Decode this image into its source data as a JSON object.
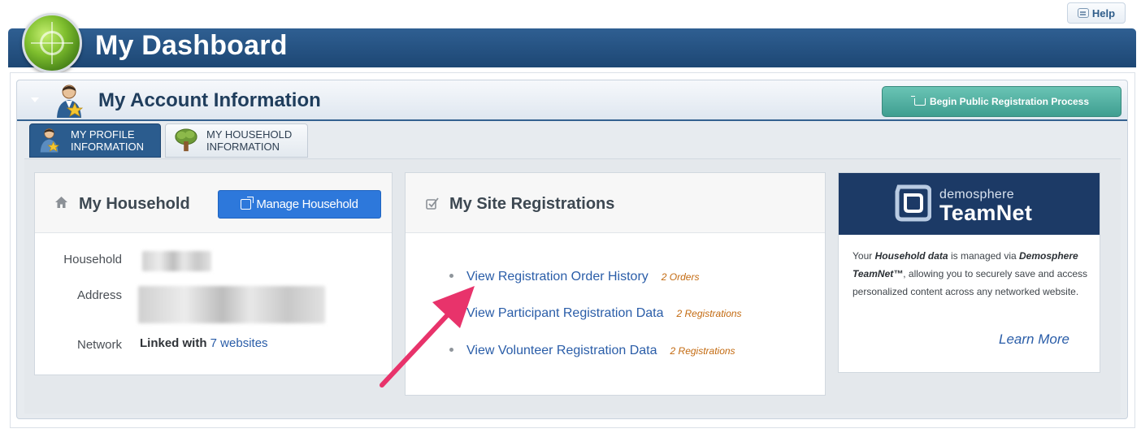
{
  "help": {
    "label": "Help"
  },
  "dashboard": {
    "title": "My Dashboard"
  },
  "account": {
    "title": "My Account Information",
    "begin_button": "Begin Public Registration Process",
    "tabs": [
      {
        "label": "My Profile Information",
        "active": true
      },
      {
        "label": "My Household Information",
        "active": false
      }
    ]
  },
  "household": {
    "title": "My Household",
    "manage_button": "Manage Household",
    "fields": {
      "household_label": "Household",
      "address_label": "Address",
      "network_label": "Network",
      "network_prefix": "Linked with",
      "network_link": "7 websites"
    }
  },
  "registrations": {
    "title": "My Site Registrations",
    "items": [
      {
        "label": "View Registration Order History",
        "count": "2 Orders"
      },
      {
        "label": "View Participant Registration Data",
        "count": "2 Registrations"
      },
      {
        "label": "View Volunteer Registration Data",
        "count": "2 Registrations"
      }
    ]
  },
  "teamnet": {
    "logo_small": "demosphere",
    "logo_big": "TeamNet",
    "body_prefix": "Your ",
    "body_bold1": "Household data",
    "body_mid": " is managed via ",
    "body_bold2": "Demosphere TeamNet™",
    "body_suffix": ", allowing you to securely save and access personalized content across any networked website.",
    "learn_more": "Learn More"
  },
  "colors": {
    "header_blue": "#1d4774",
    "link_blue": "#2a5da8",
    "button_blue": "#2d78db",
    "teal": "#3f9e90",
    "order_orange": "#c36a10",
    "annotation_pink": "#e8336b"
  },
  "icons": {
    "help": "chat-icon",
    "globe": "globe-logo",
    "account": "user-star-icon",
    "cart": "cart-icon",
    "home": "home-icon",
    "check": "checkbox-icon",
    "external": "external-link-icon",
    "teamnet": "teamnet-logo"
  }
}
